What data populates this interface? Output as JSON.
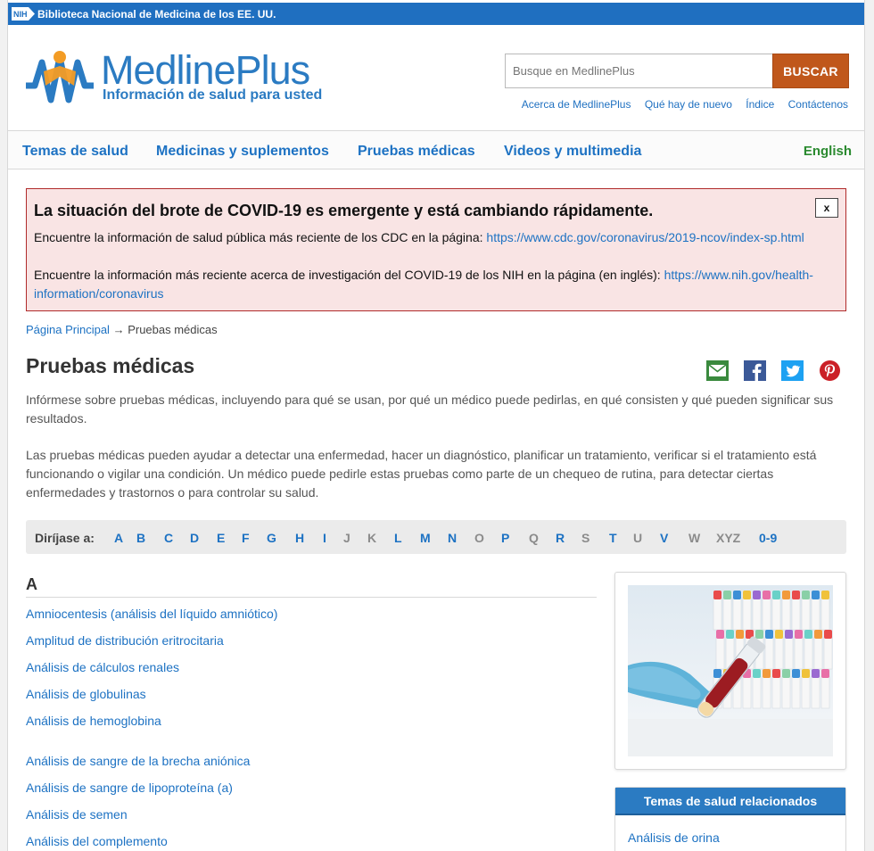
{
  "nih_bar": {
    "icon": "nih-icon",
    "text": "Biblioteca Nacional de Medicina de los EE. UU."
  },
  "logo": {
    "word_main": "Medline",
    "word_plus": "Plus",
    "tagline": "Información de salud para usted"
  },
  "search": {
    "placeholder": "Busque en MedlinePlus",
    "button": "BUSCAR"
  },
  "top_links": [
    "Acerca de MedlinePlus",
    "Qué hay de nuevo",
    "Índice",
    "Contáctenos"
  ],
  "nav": {
    "items": [
      "Temas de salud",
      "Medicinas y suplementos",
      "Pruebas médicas",
      "Videos y multimedia"
    ],
    "language": "English"
  },
  "alert": {
    "title": "La situación del brote de COVID-19 es emergente y está cambiando rápidamente.",
    "close": "x",
    "line1_text": "Encuentre la información de salud pública más reciente de los CDC en la página: ",
    "line1_link": "https://www.cdc.gov/coronavirus/2019-ncov/index-sp.html",
    "line2_text": "Encuentre la información más reciente acerca de investigación del COVID-19 de los NIH en la página (en inglés): ",
    "line2_link": "https://www.nih.gov/health-information/coronavirus"
  },
  "breadcrumb": {
    "home": "Página Principal",
    "separator": " → ",
    "current": "Pruebas médicas"
  },
  "page_title": "Pruebas médicas",
  "share_icons": [
    "email-icon",
    "facebook-icon",
    "twitter-icon",
    "pinterest-icon"
  ],
  "intro": [
    "Infórmese sobre pruebas médicas, incluyendo para qué se usan, por qué un médico puede pedirlas, en qué consisten y qué pueden significar sus resultados.",
    "Las pruebas médicas pueden ayudar a detectar una enfermedad, hacer un diagnóstico, planificar un tratamiento, verificar si el tratamiento está funcionando o vigilar una condición. Un médico puede pedirle estas pruebas como parte de un chequeo de rutina, para detectar ciertas enfermedades y trastornos o para controlar su salud."
  ],
  "alphabet": {
    "label": "Diríjase a:",
    "letters": [
      {
        "l": "A",
        "active": true
      },
      {
        "l": "B",
        "active": true
      },
      {
        "l": "C",
        "active": true
      },
      {
        "l": "D",
        "active": true
      },
      {
        "l": "E",
        "active": true
      },
      {
        "l": "F",
        "active": true
      },
      {
        "l": "G",
        "active": true
      },
      {
        "l": "H",
        "active": true
      },
      {
        "l": "I",
        "active": true
      },
      {
        "l": "J",
        "active": false
      },
      {
        "l": "K",
        "active": false
      },
      {
        "l": "L",
        "active": true
      },
      {
        "l": "M",
        "active": true
      },
      {
        "l": "N",
        "active": true
      },
      {
        "l": "O",
        "active": false
      },
      {
        "l": "P",
        "active": true
      },
      {
        "l": "Q",
        "active": false
      },
      {
        "l": "R",
        "active": true
      },
      {
        "l": "S",
        "active": false
      },
      {
        "l": "T",
        "active": true
      },
      {
        "l": "U",
        "active": false
      },
      {
        "l": "V",
        "active": true
      },
      {
        "l": "W",
        "active": false
      },
      {
        "l": "XYZ",
        "active": false
      },
      {
        "l": "0-9",
        "active": true
      }
    ]
  },
  "section": {
    "letter": "A",
    "items": [
      "Amniocentesis (análisis del líquido amniótico)",
      "Amplitud de distribución eritrocitaria",
      "Análisis de cálculos renales",
      "Análisis de globulinas",
      "Análisis de hemoglobina",
      "Análisis de sangre de la brecha aniónica",
      "Análisis de sangre de lipoproteína (a)",
      "Análisis de semen",
      "Análisis del complemento"
    ]
  },
  "sidebar": {
    "image_icon": "blood-test-tubes-photo",
    "related_title": "Temas de salud relacionados",
    "related_items": [
      "Análisis de orina"
    ]
  },
  "colors": {
    "brand_blue": "#2b7bc2",
    "link": "#1d72c3",
    "search_button": "#c0571b",
    "alert_border": "#b02a2a",
    "alert_bg": "#f9e4e4",
    "english": "#2a8a2f"
  }
}
